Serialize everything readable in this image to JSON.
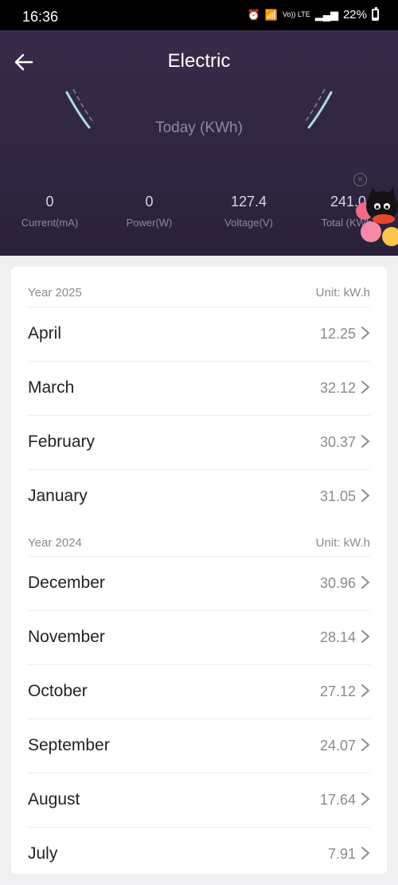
{
  "status": {
    "time": "16:36",
    "network": "Vo)) LTE",
    "battery": "22%"
  },
  "header": {
    "title": "Electric",
    "gauge_label": "Today (KWh)",
    "stats": [
      {
        "value": "0",
        "label": "Current(mA)"
      },
      {
        "value": "0",
        "label": "Power(W)"
      },
      {
        "value": "127.4",
        "label": "Voltage(V)"
      },
      {
        "value": "241.0",
        "label": "Total (KWh)"
      }
    ]
  },
  "history": {
    "years": [
      {
        "year_label": "Year 2025",
        "unit_label": "Unit: kW.h",
        "months": [
          {
            "name": "April",
            "value": "12.25"
          },
          {
            "name": "March",
            "value": "32.12"
          },
          {
            "name": "February",
            "value": "30.37"
          },
          {
            "name": "January",
            "value": "31.05"
          }
        ]
      },
      {
        "year_label": "Year 2024",
        "unit_label": "Unit: kW.h",
        "months": [
          {
            "name": "December",
            "value": "30.96"
          },
          {
            "name": "November",
            "value": "28.14"
          },
          {
            "name": "October",
            "value": "27.12"
          },
          {
            "name": "September",
            "value": "24.07"
          },
          {
            "name": "August",
            "value": "17.64"
          },
          {
            "name": "July",
            "value": "7.91"
          }
        ]
      }
    ]
  },
  "colors": {
    "header_bg": "#2f2640",
    "gauge_accent": "#a8dde0",
    "text_muted": "#8a8a90"
  }
}
